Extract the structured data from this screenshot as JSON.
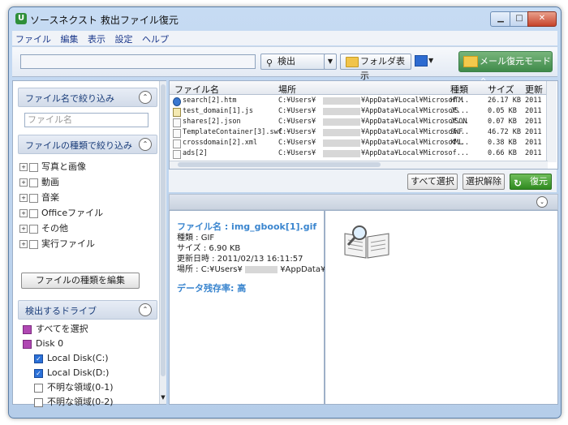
{
  "window": {
    "title": "ソースネクスト 救出ファイル復元",
    "app_icon": "U"
  },
  "menu": [
    "ファイル",
    "編集",
    "表示",
    "設定",
    "ヘルプ"
  ],
  "toolbar": {
    "detect_label": "検出",
    "folder_label": "フォルダ表示",
    "mail_label": "メール復元モードへ"
  },
  "left": {
    "filename_section": "ファイル名で絞り込み",
    "filename_placeholder": "ファイル名",
    "type_section": "ファイルの種類で絞り込み",
    "types": [
      "写真と画像",
      "動画",
      "音楽",
      "Officeファイル",
      "その他",
      "実行ファイル"
    ],
    "edit_types_label": "ファイルの種類を編集",
    "drive_section": "検出するドライブ",
    "select_all": "すべてを選択",
    "disk": "Disk  0",
    "drives": [
      {
        "label": "Local Disk(C:)",
        "checked": true
      },
      {
        "label": "Local Disk(D:)",
        "checked": true
      },
      {
        "label": "不明な領域(0-1)",
        "checked": false
      },
      {
        "label": "不明な領域(0-2)",
        "checked": false
      }
    ]
  },
  "files": {
    "columns": [
      "ファイル名",
      "場所",
      "種類",
      "サイズ",
      "更新"
    ],
    "rows": [
      {
        "name": "search[2].htm",
        "loc1": "C:¥Users¥",
        "loc2": "¥AppData¥Local¥Microsof...",
        "type": "HTM",
        "size": "26.17 KB",
        "date": "2011",
        "icon": "ie"
      },
      {
        "name": "test_domain[1].js",
        "loc1": "C:¥Users¥",
        "loc2": "¥AppData¥Local¥Microsof...",
        "type": "JS",
        "size": "0.05 KB",
        "date": "2011",
        "icon": "js"
      },
      {
        "name": "shares[2].json",
        "loc1": "C:¥Users¥",
        "loc2": "¥AppData¥Local¥Microsof...",
        "type": "JSON",
        "size": "0.07 KB",
        "date": "2011",
        "icon": "doc"
      },
      {
        "name": "TemplateContainer[3].swf",
        "loc1": "C:¥Users¥",
        "loc2": "¥AppData¥Local¥Microsof...",
        "type": "SWF",
        "size": "46.72 KB",
        "date": "2011",
        "icon": "doc"
      },
      {
        "name": "crossdomain[2].xml",
        "loc1": "C:¥Users¥",
        "loc2": "¥AppData¥Local¥Microsof...",
        "type": "XML",
        "size": "0.38 KB",
        "date": "2011",
        "icon": "doc"
      },
      {
        "name": "ads[2]",
        "loc1": "C:¥Users¥",
        "loc2": "¥AppData¥Local¥Microsof...",
        "type": "",
        "size": "0.66 KB",
        "date": "2011",
        "icon": "doc"
      }
    ]
  },
  "actions": {
    "select_all": "すべて選択",
    "deselect": "選択解除",
    "restore": "復元"
  },
  "detail": {
    "filename": "ファイル名 : img_gbook[1].gif",
    "type": "種類 : GIF",
    "size": "サイズ  : 6.90 KB",
    "modified": "更新日時 : 2011/02/13 16:11:57",
    "location": "場所    : C:¥Users¥",
    "location_tail": "¥AppData¥L",
    "rate": "データ残存率: 高"
  }
}
